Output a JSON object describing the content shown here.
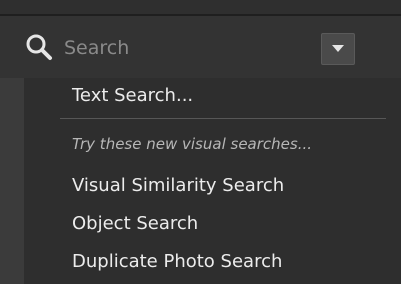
{
  "search": {
    "placeholder": "Search",
    "icon": "search-icon",
    "dropdown_icon": "caret-down-icon"
  },
  "menu": {
    "text_search": "Text Search...",
    "hint": "Try these new visual searches...",
    "items": [
      "Visual Similarity Search",
      "Object Search",
      "Duplicate Photo Search"
    ]
  },
  "colors": {
    "background": "#3b3b3b",
    "menu_background": "#2e2e2e",
    "text": "#ececec",
    "hint_text": "#b7b7b7",
    "placeholder": "#8a8a8a"
  }
}
